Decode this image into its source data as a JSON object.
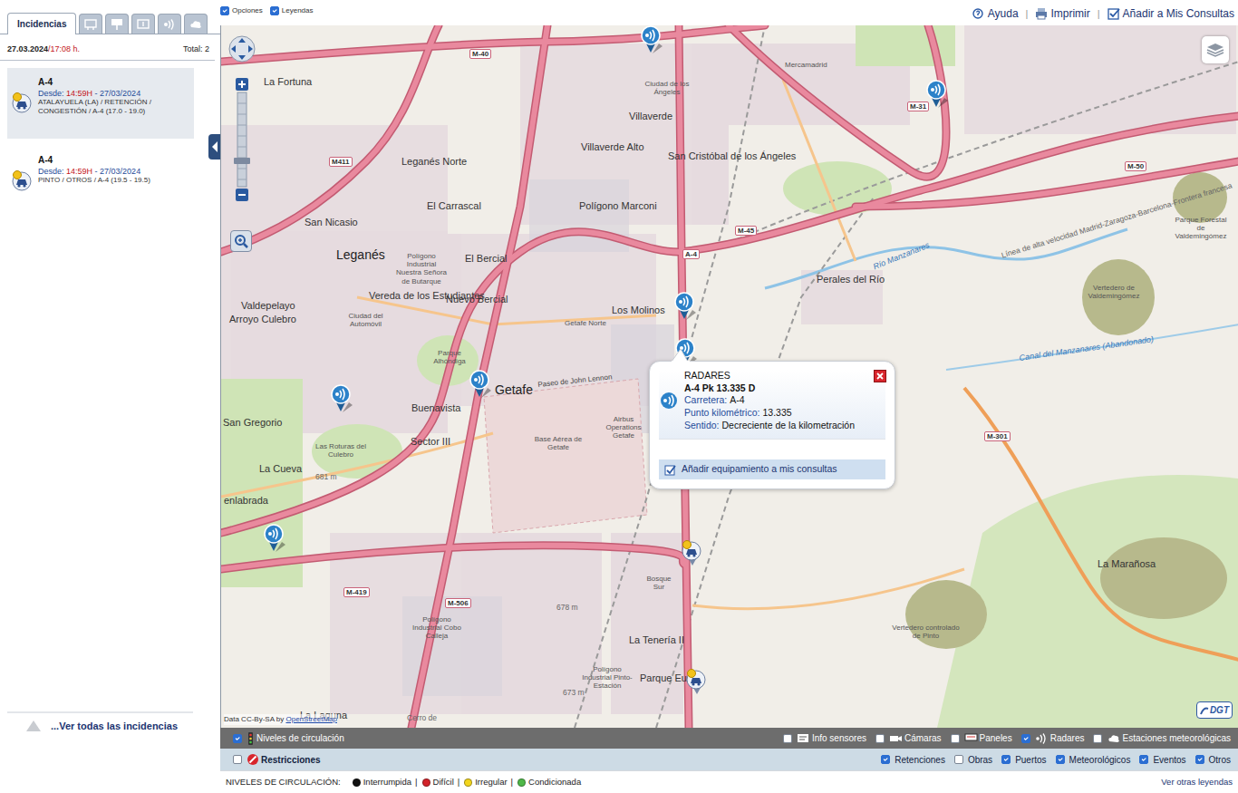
{
  "sidebar": {
    "tabs": [
      {
        "kind": "text",
        "label": "Incidencias",
        "selected": true
      },
      {
        "kind": "icon",
        "selected": false
      },
      {
        "kind": "icon",
        "selected": false
      },
      {
        "kind": "icon",
        "selected": false
      },
      {
        "kind": "icon",
        "selected": false
      },
      {
        "kind": "icon",
        "selected": false
      }
    ],
    "date": "27.03.2024",
    "time": "/17:08 h.",
    "total": "Total: 2",
    "incidents": [
      {
        "road": "A-4",
        "since": "Desde:",
        "time": "14:59H",
        "date": "- 27/03/2024",
        "description": "ATALAYUELA (LA) / RETENCIÓN / CONGESTIÓN / A-4 (17.0 - 19.0)",
        "selected": true
      },
      {
        "road": "A-4",
        "since": "Desde:",
        "time": "14:59H",
        "date": "- 27/03/2024",
        "description": "PINTO / OTROS / A-4 (19.5 - 19.5)",
        "selected": false
      }
    ],
    "see_all": "...Ver todas las incidencias"
  },
  "toolbar": {
    "options": [
      {
        "label": "Opciones",
        "checked": true
      },
      {
        "label": "Leyendas",
        "checked": true
      }
    ],
    "links": [
      "Ayuda",
      "Imprimir",
      "Añadir a Mis Consultas"
    ],
    "separator": "|"
  },
  "map": {
    "labels": [
      {
        "text": "La Fortuna",
        "kind": "place"
      },
      {
        "text": "Leganés Norte",
        "kind": "place"
      },
      {
        "text": "El Carrascal",
        "kind": "place"
      },
      {
        "text": "San Nicasio",
        "kind": "place"
      },
      {
        "text": "Leganés",
        "kind": "big"
      },
      {
        "text": "Valdepelayo",
        "kind": "place"
      },
      {
        "text": "Vereda de los Estudiantes",
        "kind": "place"
      },
      {
        "text": "Nuevo Bercial",
        "kind": "place"
      },
      {
        "text": "El Bercial",
        "kind": "place"
      },
      {
        "text": "Getafe",
        "kind": "big"
      },
      {
        "text": "Polígono Marconi",
        "kind": "place"
      },
      {
        "text": "Villaverde Alto",
        "kind": "place"
      },
      {
        "text": "Villaverde",
        "kind": "place"
      },
      {
        "text": "San Cristóbal de los Ángeles",
        "kind": "place"
      },
      {
        "text": "Ciudad de los Ángeles",
        "kind": "area"
      },
      {
        "text": "Mercamadrid",
        "kind": "area"
      },
      {
        "text": "Perales del Río",
        "kind": "place"
      },
      {
        "text": "Los Molinos",
        "kind": "place"
      },
      {
        "text": "Getafe Norte",
        "kind": "area"
      },
      {
        "text": "Buenavista",
        "kind": "place"
      },
      {
        "text": "Sector III",
        "kind": "place"
      },
      {
        "text": "Base Aérea de Getafe",
        "kind": "area"
      },
      {
        "text": "Airbus Operations Getafe",
        "kind": "area"
      },
      {
        "text": "Paseo de John Lennon",
        "kind": "street"
      },
      {
        "text": "Arroyo Culebro",
        "kind": "place"
      },
      {
        "text": "Ciudad del Automóvil",
        "kind": "area"
      },
      {
        "text": "Parque Alhóndiga",
        "kind": "area"
      },
      {
        "text": "San Gregorio",
        "kind": "place"
      },
      {
        "text": "La Cueva",
        "kind": "place"
      },
      {
        "text": "Las Roturas del Culebro",
        "kind": "area"
      },
      {
        "text": "enlabrada",
        "kind": "place"
      },
      {
        "text": "La Tenería II",
        "kind": "place"
      },
      {
        "text": "Parque Eu",
        "kind": "place"
      },
      {
        "text": "Bosque Sur",
        "kind": "area"
      },
      {
        "text": "Polígono Industrial Pinto-Estación",
        "kind": "area"
      },
      {
        "text": "Polígono Industrial Cobo Calleja",
        "kind": "area"
      },
      {
        "text": "La Laguna",
        "kind": "place"
      },
      {
        "text": "La Marañosa",
        "kind": "place"
      },
      {
        "text": "Vertedero controlado de Pinto",
        "kind": "area"
      },
      {
        "text": "Parque Forestal de Valdemingómez",
        "kind": "area"
      },
      {
        "text": "Vertedero de Valdemingómez",
        "kind": "area"
      },
      {
        "text": "Río Manzanares",
        "kind": "water"
      },
      {
        "text": "Canal del Manzanares (Abandonado)",
        "kind": "water"
      },
      {
        "text": "Línea de alta velocidad Madrid-Zaragoza-Barcelona-Frontera francesa",
        "kind": "rail"
      },
      {
        "text": "Polígono Industrial Nuestra Señora de Butarque",
        "kind": "area"
      },
      {
        "text": "681 m",
        "kind": "height"
      },
      {
        "text": "678 m",
        "kind": "height"
      },
      {
        "text": "673 m",
        "kind": "height"
      },
      {
        "text": "Cerro de",
        "kind": "height"
      },
      {
        "text": "M-40",
        "kind": "road"
      },
      {
        "text": "M-45",
        "kind": "road"
      },
      {
        "text": "A-4",
        "kind": "road"
      },
      {
        "text": "M-50",
        "kind": "road"
      },
      {
        "text": "M-31",
        "kind": "road"
      },
      {
        "text": "M-301",
        "kind": "road"
      },
      {
        "text": "M-419",
        "kind": "road"
      },
      {
        "text": "M-506",
        "kind": "road"
      },
      {
        "text": "M411",
        "kind": "road"
      }
    ],
    "pins": [
      {
        "kind": "radar"
      },
      {
        "kind": "radar"
      },
      {
        "kind": "radar"
      },
      {
        "kind": "radar"
      },
      {
        "kind": "radar"
      },
      {
        "kind": "radar"
      },
      {
        "kind": "radar"
      },
      {
        "kind": "incident"
      },
      {
        "kind": "incident"
      }
    ],
    "popup": {
      "title": "RADARES",
      "subtitle": "A-4 Pk 13.335 D",
      "fields": [
        {
          "label": "Carretera:",
          "value": "A-4"
        },
        {
          "label": "Punto kilométrico:",
          "value": "13.335"
        },
        {
          "label": "Sentido:",
          "value": "Decreciente de la kilometración"
        }
      ],
      "action": "Añadir equipamiento a mis consultas"
    },
    "attribution": "Data CC-By-SA by ",
    "attribution_link": "OpenStreetMap",
    "logo": "DGT"
  },
  "layers": {
    "main": {
      "label": "Niveles de circulación",
      "checked": true
    },
    "items": [
      {
        "label": "Info sensores",
        "checked": false
      },
      {
        "label": "Cámaras",
        "checked": false
      },
      {
        "label": "Paneles",
        "checked": false
      },
      {
        "label": "Radares",
        "checked": true
      },
      {
        "label": "Estaciones meteorológicas",
        "checked": false
      }
    ]
  },
  "filters": {
    "main": {
      "label": "Restricciones",
      "checked": false
    },
    "items": [
      {
        "label": "Retenciones",
        "checked": true
      },
      {
        "label": "Obras",
        "checked": false
      },
      {
        "label": "Puertos",
        "checked": true
      },
      {
        "label": "Meteorológicos",
        "checked": true
      },
      {
        "label": "Eventos",
        "checked": true
      },
      {
        "label": "Otros",
        "checked": true
      }
    ]
  },
  "legend": {
    "title": "NIVELES DE CIRCULACIÓN:",
    "separator": "|",
    "items": [
      {
        "label": "Interrumpida",
        "color": "#111111"
      },
      {
        "label": "Difícil",
        "color": "#d2232a"
      },
      {
        "label": "Irregular",
        "color": "#f2d51c"
      },
      {
        "label": "Condicionada",
        "color": "#4fb848"
      }
    ],
    "more": "Ver otras leyendas"
  }
}
